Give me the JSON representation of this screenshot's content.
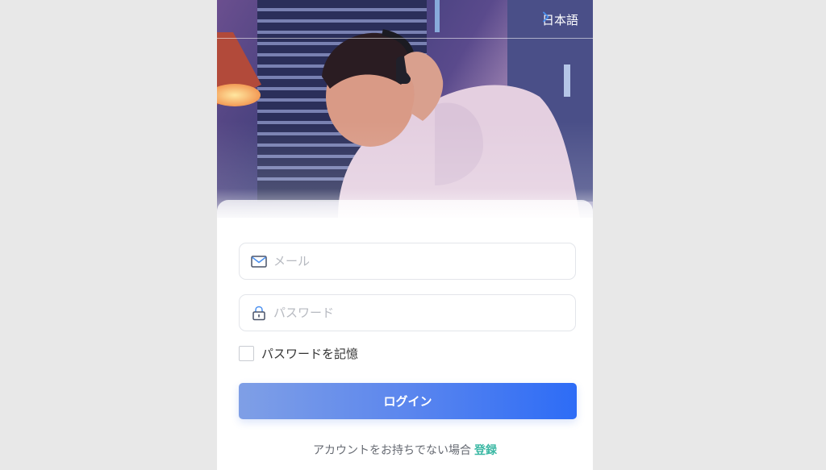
{
  "header": {
    "language_label": "日本語"
  },
  "form": {
    "email_placeholder": "メール",
    "email_value": "",
    "password_placeholder": "パスワード",
    "password_value": "",
    "remember_label": "パスワードを記憶",
    "remember_checked": false,
    "login_label": "ログイン"
  },
  "footer": {
    "no_account_text": "アカウントをお持ちでない場合",
    "register_link": "登録"
  },
  "colors": {
    "accent": "#2d6cf6",
    "link": "#3bb8a4"
  },
  "icons": {
    "email": "mail-icon",
    "password": "lock-icon",
    "language": "chevron-right-icon"
  }
}
